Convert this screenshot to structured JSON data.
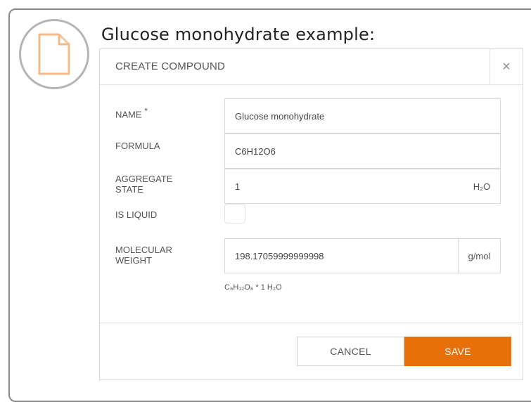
{
  "heading": "Glucose monohydrate example:",
  "icons": {
    "document": "document-icon",
    "close": "close-icon"
  },
  "dialog": {
    "title": "CREATE COMPOUND",
    "close_label": "×",
    "fields": {
      "name": {
        "label": "NAME",
        "required_mark": "*",
        "value": "Glucose monohydrate"
      },
      "formula": {
        "label": "FORMULA",
        "value": "C6H12O6"
      },
      "aggregate_state": {
        "label_line1": "AGGREGATE",
        "label_line2": "STATE",
        "value": "1",
        "unit": "H₂O"
      },
      "is_liquid": {
        "label": "IS LIQUID",
        "checked": false
      },
      "molecular_weight": {
        "label_line1": "MOLECULAR",
        "label_line2": "WEIGHT",
        "value": "198.17059999999998",
        "unit": "g/mol"
      }
    },
    "formula_preview": "C₆H₁₂O₆ * 1 H₂O",
    "buttons": {
      "cancel": "CANCEL",
      "save": "SAVE"
    }
  },
  "colors": {
    "accent": "#e8700a",
    "document_icon": "#f2b98a"
  }
}
